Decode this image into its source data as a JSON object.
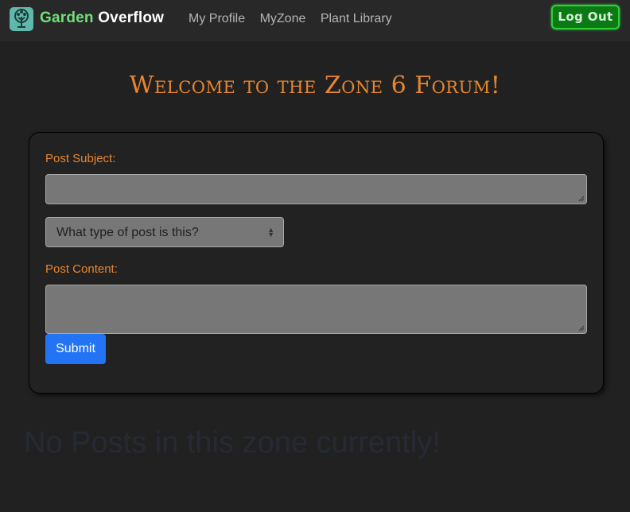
{
  "nav": {
    "brand_part1": "Garden",
    "brand_part2": "Overflow",
    "links": [
      "My Profile",
      "MyZone",
      "Plant Library"
    ],
    "logout_label": "Log Out"
  },
  "main": {
    "heading": "Welcome to the Zone 6 Forum!",
    "form": {
      "subject_label": "Post Subject:",
      "subject_value": "",
      "post_type_selected": "What type of post is this?",
      "content_label": "Post Content:",
      "content_value": "",
      "submit_label": "Submit"
    },
    "empty_message": "No Posts in this zone currently!"
  },
  "colors": {
    "background": "#212121",
    "navbar": "#282828",
    "accent_orange": "#e8862f",
    "brand_green": "#6fe07a",
    "logout_green": "#0c7a14",
    "submit_blue": "#2373f5"
  },
  "icons": {
    "brand_logo": "tree-icon",
    "select_arrow": "chevron-up-down-icon"
  }
}
